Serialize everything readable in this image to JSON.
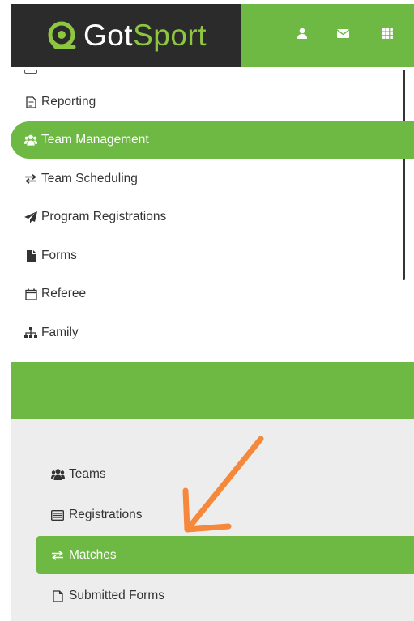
{
  "header": {
    "logo_got": "Got",
    "logo_sport": "Sport",
    "icons": [
      "user-icon",
      "envelope-icon",
      "grid-icon"
    ]
  },
  "sidebar": {
    "items": [
      {
        "label": "Reporting",
        "icon": "document-icon"
      },
      {
        "label": "Team Management",
        "icon": "users-icon",
        "active": true
      },
      {
        "label": "Team Scheduling",
        "icon": "exchange-icon"
      },
      {
        "label": "Program Registrations",
        "icon": "paper-plane-icon"
      },
      {
        "label": "Forms",
        "icon": "file-icon"
      },
      {
        "label": "Referee",
        "icon": "calendar-icon"
      },
      {
        "label": "Family",
        "icon": "sitemap-icon"
      }
    ]
  },
  "submenu": {
    "items": [
      {
        "label": "Teams",
        "icon": "users-icon"
      },
      {
        "label": "Registrations",
        "icon": "list-card-icon"
      },
      {
        "label": "Matches",
        "icon": "exchange-icon",
        "active": true
      },
      {
        "label": "Submitted Forms",
        "icon": "document-icon"
      }
    ]
  },
  "colors": {
    "accent": "#6db944",
    "logo_dark": "#2b2b2b",
    "logo_green": "#8dc63f",
    "arrow": "#f5883a",
    "submenu_bg": "#ededed"
  }
}
